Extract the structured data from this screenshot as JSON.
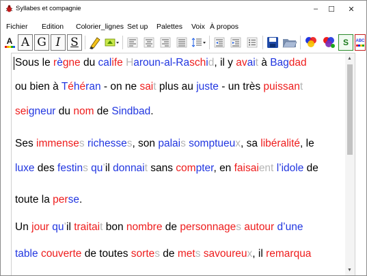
{
  "window": {
    "title": "Syllabes et compagnie"
  },
  "window_controls": {
    "minimize": "–",
    "maximize": "☐",
    "close": "✕"
  },
  "menu": [
    "Fichier",
    "Edition",
    "Colorier_lignes",
    "Set up",
    "Palettes",
    "Voix",
    "À propos"
  ],
  "toolbar": {
    "format": {
      "letters": "A",
      "bold": "A",
      "serif": "G",
      "italic": "I",
      "underline": "S"
    },
    "syllable_button": "S",
    "abc_button": "ABC"
  },
  "icons": [
    "bug-icon",
    "font-color-icon",
    "highlighter-icon",
    "highlight-color-icon",
    "align-left-icon",
    "align-center-icon",
    "align-right-icon",
    "justify-icon",
    "line-spacing-icon",
    "indent-decrease-icon",
    "indent-increase-icon",
    "list-icon",
    "save-icon",
    "open-folder-icon",
    "color-syllables-icon",
    "color-syllables-2-icon"
  ],
  "colors": {
    "red": "#ee1c1c",
    "blue": "#2136e0",
    "gray": "#b5b5b5",
    "black": "#000000"
  },
  "document": {
    "lines": [
      [
        [
          "k",
          "Sous le "
        ],
        [
          "r",
          "r"
        ],
        [
          "b",
          "è"
        ],
        [
          "r",
          "gne"
        ],
        [
          "k",
          " du "
        ],
        [
          "b",
          "cal"
        ],
        [
          "r",
          "ife "
        ],
        [
          "g",
          "H"
        ],
        [
          "b",
          "aroun-al-Ra"
        ],
        [
          "r",
          "sch"
        ],
        [
          "b",
          "i"
        ],
        [
          "g",
          "d"
        ],
        [
          "k",
          ", il y "
        ],
        [
          "r",
          "av"
        ],
        [
          "b",
          "ai"
        ],
        [
          "g",
          "t"
        ],
        [
          "k",
          " à "
        ],
        [
          "b",
          "Bag"
        ],
        [
          "r",
          "dad"
        ]
      ],
      [
        [
          "k",
          "ou bien à "
        ],
        [
          "b",
          "T"
        ],
        [
          "r",
          "é"
        ],
        [
          "b",
          "h"
        ],
        [
          "r",
          "é"
        ],
        [
          "b",
          "ran"
        ],
        [
          "k",
          " - on ne "
        ],
        [
          "r",
          "sai"
        ],
        [
          "g",
          "t"
        ],
        [
          "k",
          " plus au "
        ],
        [
          "b",
          "juste"
        ],
        [
          "k",
          " - un très "
        ],
        [
          "r",
          "puissan"
        ],
        [
          "g",
          "t"
        ]
      ],
      [
        [
          "r",
          "sei"
        ],
        [
          "b",
          "gneur"
        ],
        [
          "k",
          " du "
        ],
        [
          "r",
          "nom"
        ],
        [
          "k",
          " de "
        ],
        [
          "b",
          "Sindbad"
        ],
        [
          "k",
          "."
        ]
      ],
      [
        [
          "k",
          "Ses "
        ],
        [
          "r",
          "immense"
        ],
        [
          "g",
          "s"
        ],
        [
          "k",
          " "
        ],
        [
          "b",
          "richesse"
        ],
        [
          "g",
          "s"
        ],
        [
          "k",
          ", son "
        ],
        [
          "b",
          "palai"
        ],
        [
          "g",
          "s"
        ],
        [
          "k",
          " "
        ],
        [
          "b",
          "somptueu"
        ],
        [
          "g",
          "x"
        ],
        [
          "k",
          ", sa "
        ],
        [
          "r",
          "libéralité"
        ],
        [
          "k",
          ", le"
        ]
      ],
      [
        [
          "b",
          "luxe"
        ],
        [
          "k",
          " des "
        ],
        [
          "b",
          "festin"
        ],
        [
          "g",
          "s"
        ],
        [
          "k",
          " "
        ],
        [
          "b",
          "qu"
        ],
        [
          "g",
          "’"
        ],
        [
          "k",
          "il "
        ],
        [
          "b",
          "donnai"
        ],
        [
          "g",
          "t"
        ],
        [
          "k",
          " sans "
        ],
        [
          "r",
          "com"
        ],
        [
          "b",
          "pter"
        ],
        [
          "k",
          ", en "
        ],
        [
          "r",
          "faisai"
        ],
        [
          "g",
          "ent"
        ],
        [
          "k",
          " "
        ],
        [
          "b",
          "l’idole"
        ],
        [
          "k",
          " de"
        ]
      ],
      [
        [
          "k",
          "toute la "
        ],
        [
          "r",
          "per"
        ],
        [
          "b",
          "se"
        ],
        [
          "k",
          "."
        ]
      ],
      [
        [
          "k",
          "Un "
        ],
        [
          "r",
          "jour"
        ],
        [
          "k",
          " "
        ],
        [
          "b",
          "qu"
        ],
        [
          "g",
          "’"
        ],
        [
          "k",
          "il "
        ],
        [
          "r",
          "traitai"
        ],
        [
          "g",
          "t"
        ],
        [
          "k",
          " bon "
        ],
        [
          "r",
          "nombre"
        ],
        [
          "k",
          " de "
        ],
        [
          "r",
          "personnage"
        ],
        [
          "g",
          "s"
        ],
        [
          "k",
          " "
        ],
        [
          "r",
          "autour"
        ],
        [
          "k",
          " "
        ],
        [
          "b",
          "d’une"
        ]
      ],
      [
        [
          "b",
          "table"
        ],
        [
          "k",
          " "
        ],
        [
          "r",
          "couverte"
        ],
        [
          "k",
          " de toutes "
        ],
        [
          "r",
          "sorte"
        ],
        [
          "g",
          "s"
        ],
        [
          "k",
          " de "
        ],
        [
          "r",
          "met"
        ],
        [
          "g",
          "s"
        ],
        [
          "k",
          " "
        ],
        [
          "r",
          "savoureu"
        ],
        [
          "g",
          "x"
        ],
        [
          "k",
          ", il "
        ],
        [
          "r",
          "remarqua"
        ]
      ]
    ]
  }
}
